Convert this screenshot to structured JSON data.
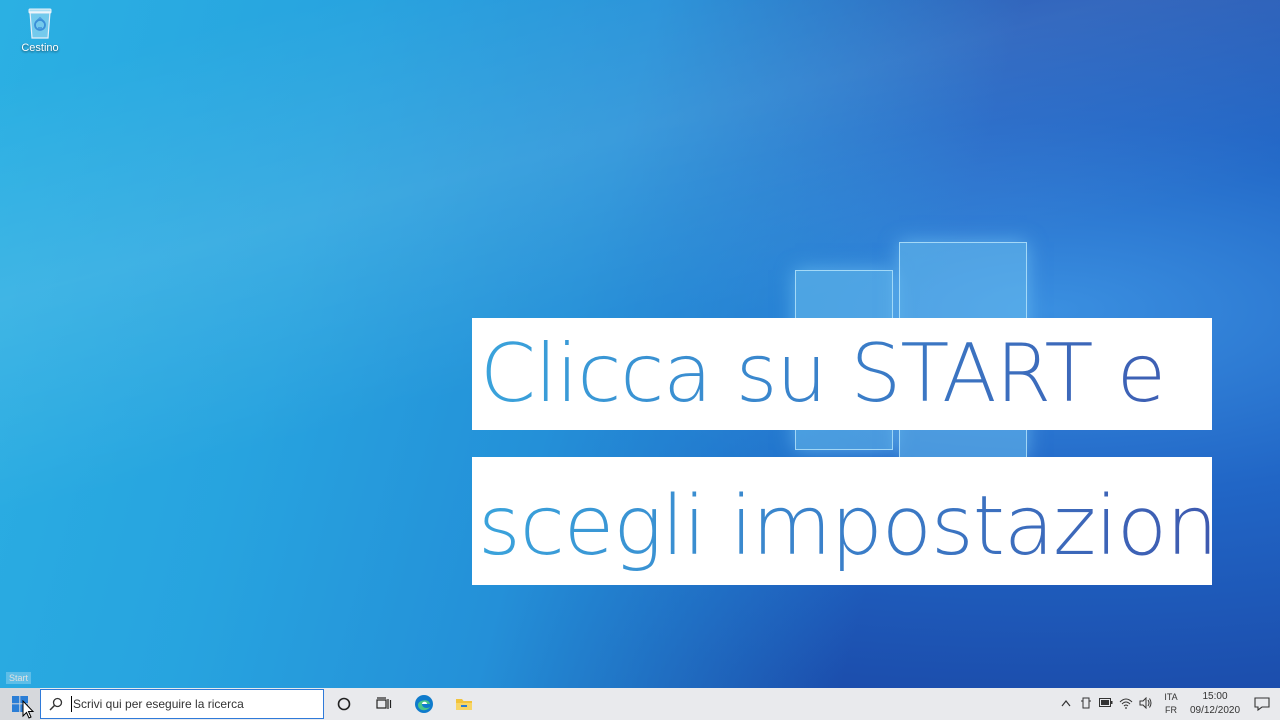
{
  "desktop": {
    "recycle_bin_label": "Cestino",
    "caption_line1": "Clicca su START e",
    "caption_line2": "scegli impostazioni",
    "start_tooltip": "Start"
  },
  "taskbar": {
    "search_placeholder": "Scrivi qui per eseguire la ricerca",
    "icons": [
      "windows-start-icon",
      "search-icon",
      "cortana-icon",
      "task-view-icon",
      "edge-icon",
      "file-explorer-icon"
    ]
  },
  "tray": {
    "icons": [
      "chevron-up-icon",
      "device-icon",
      "battery-icon",
      "wifi-icon",
      "volume-icon"
    ],
    "lang_top": "ITA",
    "lang_bottom": "FR",
    "time": "15:00",
    "date": "09/12/2020"
  },
  "colors": {
    "taskbar_bg": "#e9eaed",
    "search_border": "#2f7ad9",
    "caption_text_start": "#3aa4dc",
    "caption_text_end": "#3e5ab0"
  }
}
